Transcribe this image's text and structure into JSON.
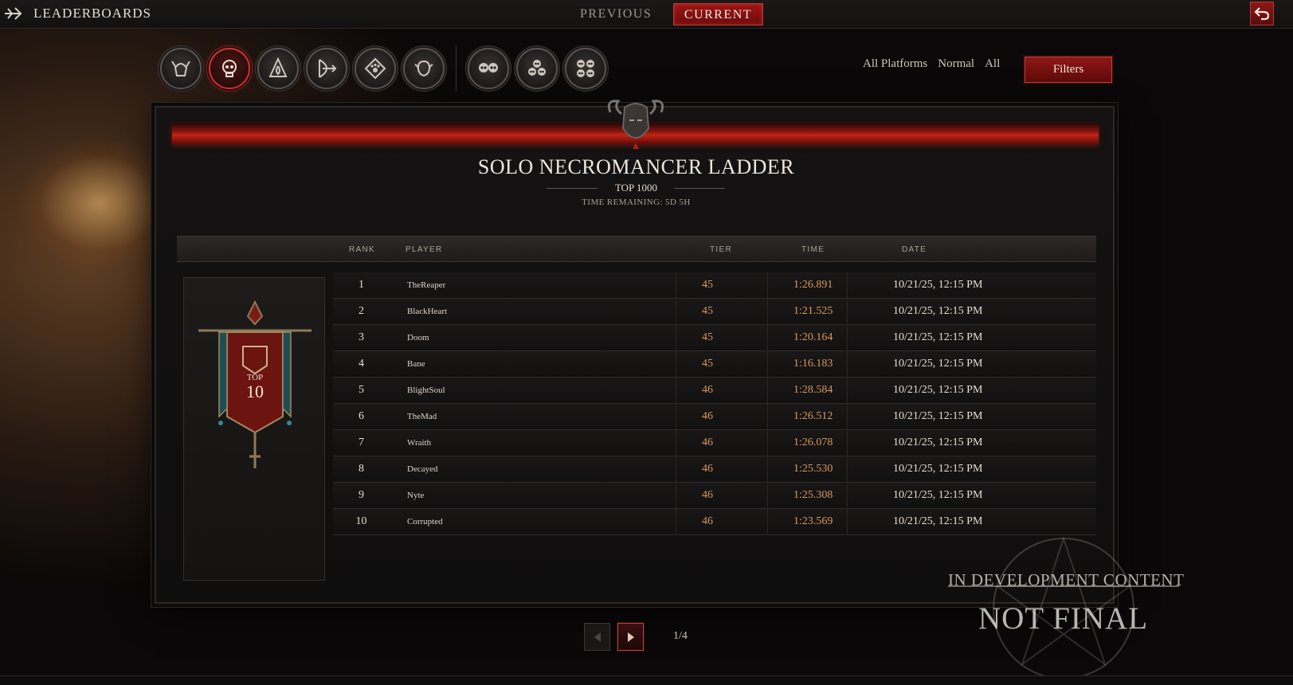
{
  "header": {
    "title": "LEADERBOARDS",
    "tabs": [
      {
        "label": "PREVIOUS",
        "active": false
      },
      {
        "label": "CURRENT",
        "active": true
      }
    ]
  },
  "class_icons": [
    {
      "icon": "barbarian-helm-icon",
      "active": false
    },
    {
      "icon": "necromancer-skull-icon",
      "active": true
    },
    {
      "icon": "sorcerer-flame-icon",
      "active": false
    },
    {
      "icon": "rogue-bow-icon",
      "active": false
    },
    {
      "icon": "druid-paw-icon",
      "active": false
    },
    {
      "icon": "spiritborn-beast-icon",
      "active": false
    },
    {
      "icon": "party-duo-skull-icon",
      "active": false
    },
    {
      "icon": "party-trio-skull-icon",
      "active": false
    },
    {
      "icon": "party-quad-skull-icon",
      "active": false
    }
  ],
  "filters": {
    "platform": "All Platforms",
    "mode": "Normal",
    "scope": "All",
    "button_label": "Filters"
  },
  "ladder": {
    "title": "SOLO NECROMANCER LADDER",
    "subtitle": "TOP 1000",
    "time_remaining": "TIME REMAINING: 5D 5H"
  },
  "table": {
    "columns": {
      "rank": "RANK",
      "player": "PLAYER",
      "tier": "TIER",
      "time": "TIME",
      "date": "DATE"
    },
    "rows": [
      {
        "rank": "1",
        "player": "TheReaper",
        "tier": "45",
        "time": "1:26.891",
        "date": "10/21/25, 12:15 PM"
      },
      {
        "rank": "2",
        "player": "BlackHeart",
        "tier": "45",
        "time": "1:21.525",
        "date": "10/21/25, 12:15 PM"
      },
      {
        "rank": "3",
        "player": "Doom",
        "tier": "45",
        "time": "1:20.164",
        "date": "10/21/25, 12:15 PM"
      },
      {
        "rank": "4",
        "player": "Bane",
        "tier": "45",
        "time": "1:16.183",
        "date": "10/21/25, 12:15 PM"
      },
      {
        "rank": "5",
        "player": "BlightSoul",
        "tier": "46",
        "time": "1:28.584",
        "date": "10/21/25, 12:15 PM"
      },
      {
        "rank": "6",
        "player": "TheMad",
        "tier": "46",
        "time": "1:26.512",
        "date": "10/21/25, 12:15 PM"
      },
      {
        "rank": "7",
        "player": "Wraith",
        "tier": "46",
        "time": "1:26.078",
        "date": "10/21/25, 12:15 PM"
      },
      {
        "rank": "8",
        "player": "Decayed",
        "tier": "46",
        "time": "1:25.530",
        "date": "10/21/25, 12:15 PM"
      },
      {
        "rank": "9",
        "player": "Nyte",
        "tier": "46",
        "time": "1:25.308",
        "date": "10/21/25, 12:15 PM"
      },
      {
        "rank": "10",
        "player": "Corrupted",
        "tier": "46",
        "time": "1:23.569",
        "date": "10/21/25, 12:15 PM"
      }
    ]
  },
  "banner": {
    "top_label": "TOP",
    "top_number": "10"
  },
  "pagination": {
    "label": "1/4",
    "current": 1,
    "total": 4
  },
  "watermark": {
    "line1": "IN DEVELOPMENT CONTENT",
    "line2": "NOT FINAL"
  },
  "colors": {
    "accent_red": "#c22416",
    "value_orange": "#d99a5c",
    "text": "#d8d2c8"
  }
}
